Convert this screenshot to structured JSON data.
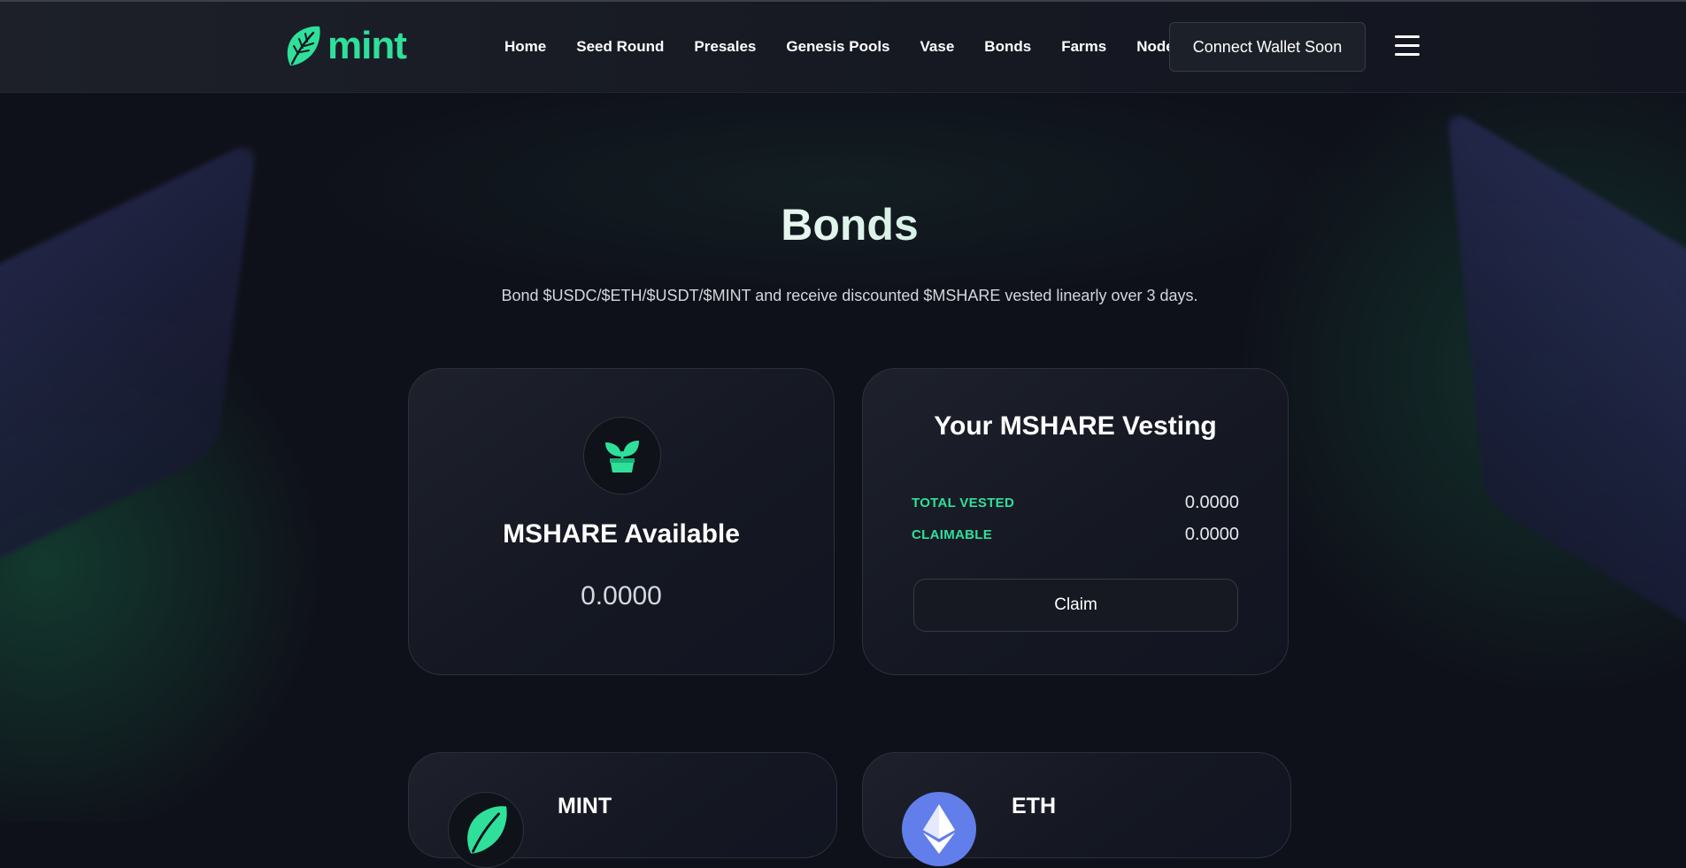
{
  "header": {
    "logo_text": "mint",
    "nav": [
      "Home",
      "Seed Round",
      "Presales",
      "Genesis Pools",
      "Vase",
      "Bonds",
      "Farms",
      "Nodes"
    ],
    "connect_button": "Connect Wallet Soon",
    "menu_icon": "hamburger-icon"
  },
  "page": {
    "title": "Bonds",
    "subtitle": "Bond $USDC/$ETH/$USDT/$MINT and receive discounted $MSHARE vested linearly over 3 days."
  },
  "available_card": {
    "icon": "plant-icon",
    "title": "MSHARE Available",
    "value": "0.0000"
  },
  "vesting_card": {
    "title": "Your MSHARE Vesting",
    "rows": [
      {
        "label": "TOTAL VESTED",
        "value": "0.0000"
      },
      {
        "label": "CLAIMABLE",
        "value": "0.0000"
      }
    ],
    "claim_button": "Claim"
  },
  "bond_cards": [
    {
      "token": "MINT",
      "icon": "mint-logo-icon"
    },
    {
      "token": "ETH",
      "icon": "ethereum-icon"
    }
  ],
  "colors": {
    "accent": "#2fe09a",
    "background": "#0f111a",
    "card": "#181b25",
    "eth_blue": "#627eea"
  }
}
